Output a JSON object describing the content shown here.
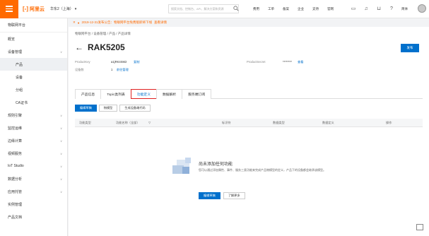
{
  "topbar": {
    "logo_text": "阿里云",
    "region": "华东2（上海）",
    "search_placeholder": "搜索文档、控制台、API、解决方案和资源",
    "nav": [
      "费用",
      "工单",
      "备案",
      "企业",
      "支持",
      "官网"
    ],
    "lang": "简体"
  },
  "sidebar": {
    "title": "物联网平台",
    "items": [
      {
        "label": "概览",
        "chevron": false,
        "sub": false,
        "active": false
      },
      {
        "label": "设备管理",
        "chevron": true,
        "sub": false,
        "active": false
      },
      {
        "label": "产品",
        "chevron": false,
        "sub": true,
        "active": true
      },
      {
        "label": "设备",
        "chevron": false,
        "sub": true,
        "active": false
      },
      {
        "label": "分组",
        "chevron": false,
        "sub": true,
        "active": false
      },
      {
        "label": "CA证书",
        "chevron": false,
        "sub": true,
        "active": false
      },
      {
        "label": "规则引擎",
        "chevron": true,
        "sub": false,
        "active": false
      },
      {
        "label": "监控运维",
        "chevron": true,
        "sub": false,
        "active": false
      },
      {
        "label": "边缘计算",
        "chevron": true,
        "sub": false,
        "active": false
      },
      {
        "label": "视频服务",
        "chevron": true,
        "sub": false,
        "active": false
      },
      {
        "label": "IoT Studio",
        "chevron": true,
        "sub": false,
        "active": false
      },
      {
        "label": "数据分析",
        "chevron": true,
        "sub": false,
        "active": false
      },
      {
        "label": "应用托管",
        "chevron": true,
        "sub": false,
        "active": false
      },
      {
        "label": "实例管理",
        "chevron": false,
        "sub": false,
        "active": false
      },
      {
        "label": "产品文档",
        "chevron": false,
        "sub": false,
        "active": false
      }
    ]
  },
  "notice": {
    "text": "2019-12-31发布公告：物联网平台免费版即将下线",
    "link": "查看详情"
  },
  "breadcrumb": "物联网平台 / 设备管理 / 产品 / 产品详情",
  "product": {
    "name": "RAK5205",
    "publish_label": "发布",
    "productkey_label": "ProductKey",
    "productkey_value": "a1jRK4SM2",
    "copy_label": "复制",
    "device_count_label": "设备数",
    "device_count_value": "1",
    "manage_label": "前往管理",
    "secret_label": "ProductSecret",
    "secret_value": "********",
    "view_label": "查看"
  },
  "tabs": [
    "产品信息",
    "Topic类列表",
    "功能定义",
    "数据解析",
    "服务端订阅"
  ],
  "actions": [
    "编辑草稿",
    "物模型",
    "生成设备端代码"
  ],
  "table_headers": [
    "功能类型",
    "功能名称（全部）",
    "标识符",
    "数据类型",
    "数据定义",
    "操作"
  ],
  "empty": {
    "title": "尚未添加任何功能",
    "desc": "您可以通过添加属性、事件、服务三类功能来完成产品物模型的定义，产品下的设备都会继承该模型。",
    "primary": "编辑草稿",
    "secondary": "了解更多"
  }
}
